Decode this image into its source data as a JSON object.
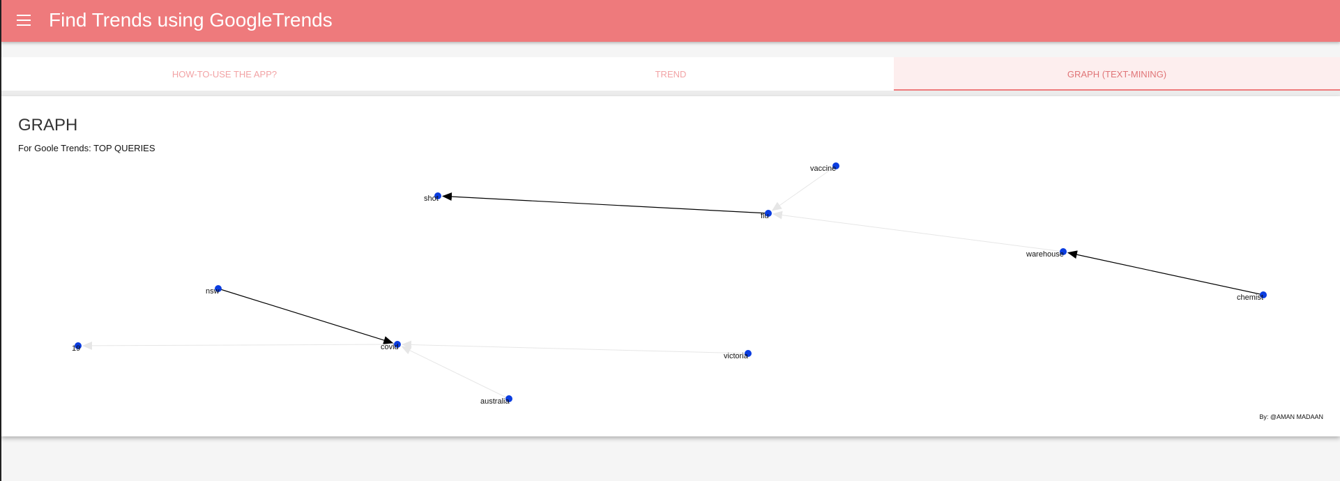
{
  "header": {
    "title": "Find Trends using GoogleTrends",
    "menu_icon": "menu-icon",
    "bar_color": "#ee7a7c"
  },
  "tabs": [
    {
      "label": "HOW-TO-USE THE APP?",
      "active": false
    },
    {
      "label": "TREND",
      "active": false
    },
    {
      "label": "GRAPH (TEXT-MINING)",
      "active": true
    }
  ],
  "graph": {
    "heading": "GRAPH",
    "subtitle": "For Goole Trends: TOP QUERIES",
    "node_color": "#0b3de0",
    "nodes": [
      {
        "id": "vaccine",
        "label": "vaccine"
      },
      {
        "id": "shot",
        "label": "shot"
      },
      {
        "id": "flu",
        "label": "flu"
      },
      {
        "id": "warehouse",
        "label": "warehouse"
      },
      {
        "id": "chemist",
        "label": "chemist"
      },
      {
        "id": "nsw",
        "label": "nsw"
      },
      {
        "id": "19",
        "label": "19"
      },
      {
        "id": "covid",
        "label": "covid"
      },
      {
        "id": "victoria",
        "label": "victoria"
      },
      {
        "id": "australia",
        "label": "australia"
      }
    ],
    "edges": [
      {
        "from": "flu",
        "to": "shot",
        "strong": true
      },
      {
        "from": "vaccine",
        "to": "flu",
        "strong": false
      },
      {
        "from": "warehouse",
        "to": "flu",
        "strong": false
      },
      {
        "from": "chemist",
        "to": "warehouse",
        "strong": true
      },
      {
        "from": "nsw",
        "to": "covid",
        "strong": true
      },
      {
        "from": "covid",
        "to": "19",
        "strong": false
      },
      {
        "from": "victoria",
        "to": "covid",
        "strong": false
      },
      {
        "from": "australia",
        "to": "covid",
        "strong": false
      }
    ]
  },
  "footer": {
    "credit": "By: @AMAN MADAAN"
  }
}
